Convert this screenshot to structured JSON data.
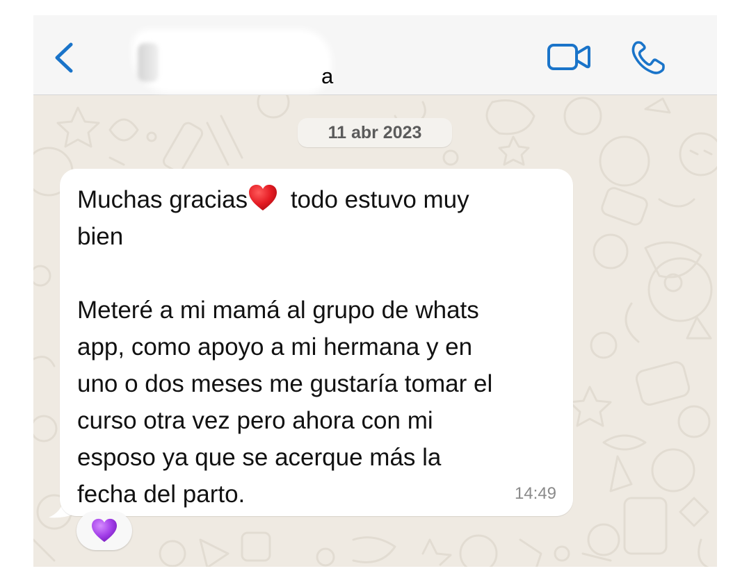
{
  "header": {
    "contact_name_visible": "a",
    "back_icon": "chevron-left-icon",
    "video_icon": "video-camera-icon",
    "call_icon": "phone-icon",
    "accent_color": "#1a74c9"
  },
  "chat": {
    "date_label": "11 abr 2023",
    "background_color": "#efeae2",
    "message": {
      "lines": [
        {
          "before_emoji": "Muchas gracias",
          "emoji": "red-heart",
          "after_emoji": " todo estuvo muy"
        },
        {
          "text": "bien"
        },
        {
          "text": ""
        },
        {
          "text": "Meteré a mi mamá al grupo de whats"
        },
        {
          "text": "app, como apoyo a mi hermana y en"
        },
        {
          "text": "uno o dos meses me gustaría tomar el"
        },
        {
          "text": "curso otra vez pero ahora con mi"
        },
        {
          "text": "esposo ya que se acerque más la"
        },
        {
          "text": "fecha del parto."
        }
      ],
      "time": "14:49",
      "reaction": "purple-heart"
    }
  }
}
